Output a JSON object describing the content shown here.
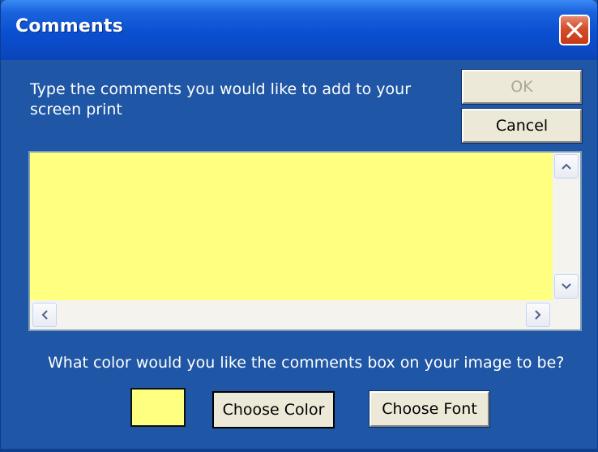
{
  "window": {
    "title": "Comments",
    "close_icon": "close-icon"
  },
  "prompt": "Type the comments you would like to add to your screen print",
  "buttons": {
    "ok": "OK",
    "cancel": "Cancel",
    "choose_color": "Choose Color",
    "choose_font": "Choose Font"
  },
  "comments": {
    "value": "",
    "background_color": "#FFFF80"
  },
  "color_question": "What color would you like the comments box on your image to be?",
  "selected_color": "#FFFF80",
  "colors": {
    "window_blue": "#1F56A5",
    "titlebar_blue": "#0A4FD1",
    "close_red": "#D44D29",
    "button_face": "#ECE9D8"
  }
}
